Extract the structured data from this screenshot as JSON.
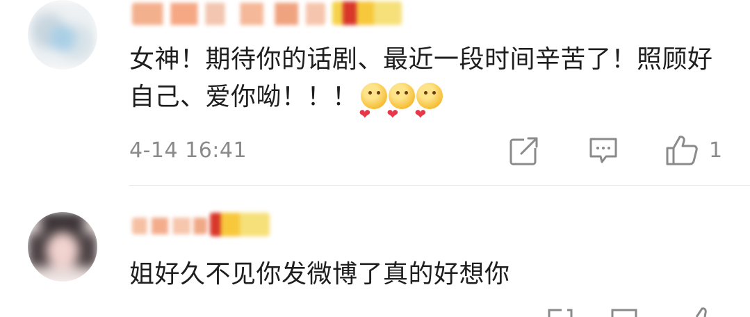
{
  "comments": [
    {
      "text": "女神！期待你的话剧、最近一段时间辛苦了！照顾好自己、爱你呦！！！",
      "emoji_icon": "heart-face-emoji",
      "emoji_count": 3,
      "timestamp": "4-14 16:41",
      "like_count": "1"
    },
    {
      "text": "姐好久不见你发微博了真的好想你"
    }
  ],
  "icons": {
    "share": "share-icon",
    "comment": "comment-icon",
    "like": "thumbs-up-icon"
  },
  "colors": {
    "text": "#1e1e1e",
    "meta": "#8a8a8a",
    "divider": "#e6e6e6",
    "background": "#ffffff"
  }
}
